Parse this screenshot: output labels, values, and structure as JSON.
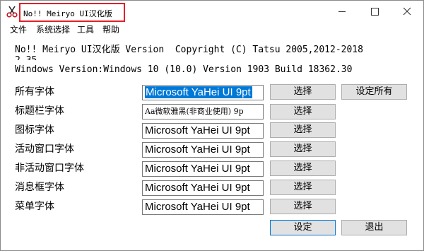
{
  "window": {
    "title": "No!! Meiryo UI汉化版",
    "icon": "app-scissors-icon",
    "controls": {
      "minimize": "minimize-icon",
      "maximize": "maximize-icon",
      "close": "close-icon"
    }
  },
  "menu": {
    "items": [
      "文件",
      "系统选择",
      "工具",
      "帮助"
    ]
  },
  "info": {
    "line1": "No!! Meiryo UI汉化版 Version  Copyright (C) Tatsu 2005,2012-2018",
    "line1_overflow": "2.35",
    "line2": "Windows Version:Windows 10 (10.0) Version 1903 Build 18362.30"
  },
  "fonts": [
    {
      "label": "所有字体",
      "value": "Microsoft YaHei UI  9pt",
      "button": "选择"
    },
    {
      "label": "标题栏字体",
      "value": "Aa微软雅黑(非商业使用) 9p",
      "button": "选择"
    },
    {
      "label": "图标字体",
      "value": "Microsoft YaHei UI  9pt",
      "button": "选择"
    },
    {
      "label": "活动窗口字体",
      "value": "Microsoft YaHei UI  9pt",
      "button": "选择"
    },
    {
      "label": "非活动窗口字体",
      "value": "Microsoft YaHei UI  9pt",
      "button": "选择"
    },
    {
      "label": "消息框字体",
      "value": "Microsoft YaHei UI  9pt",
      "button": "选择"
    },
    {
      "label": "菜单字体",
      "value": "Microsoft YaHei UI  9pt",
      "button": "选择"
    }
  ],
  "buttons": {
    "set_all": "设定所有",
    "ok": "设定",
    "exit": "退出"
  },
  "colors": {
    "title_highlight_border": "#e0202a",
    "selection": "#0078d7",
    "button_face": "#e1e1e1"
  }
}
